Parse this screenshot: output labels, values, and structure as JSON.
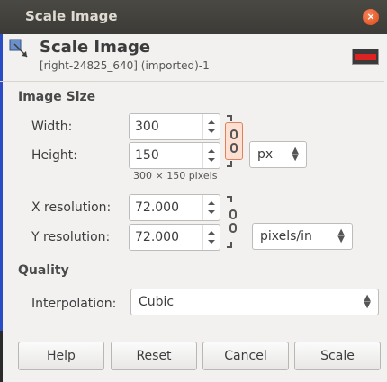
{
  "window": {
    "title": "Scale Image",
    "close_label": "×"
  },
  "header": {
    "title": "Scale Image",
    "subtitle": "[right-24825_640] (imported)-1"
  },
  "image_size": {
    "section_label": "Image Size",
    "width_label": "Width:",
    "width_value": "300",
    "height_label": "Height:",
    "height_value": "150",
    "unit": "px",
    "size_note": "300 × 150 pixels",
    "chain_linked": true
  },
  "resolution": {
    "x_label": "X resolution:",
    "x_value": "72.000",
    "y_label": "Y resolution:",
    "y_value": "72.000",
    "unit": "pixels/in",
    "chain_linked": true
  },
  "quality": {
    "section_label": "Quality",
    "interpolation_label": "Interpolation:",
    "interpolation_value": "Cubic"
  },
  "buttons": {
    "help": "Help",
    "reset": "Reset",
    "cancel": "Cancel",
    "scale": "Scale"
  },
  "colors": {
    "titlebar": "#3c3b37",
    "close": "#df4a16",
    "chain_active_fill": "#fde0d2",
    "chain_active_border": "#e0815a",
    "dialog_bg": "#f2f1f0"
  },
  "icons": {
    "header": "scale-image-icon",
    "thumbnail": "image-thumbnail-icon"
  }
}
